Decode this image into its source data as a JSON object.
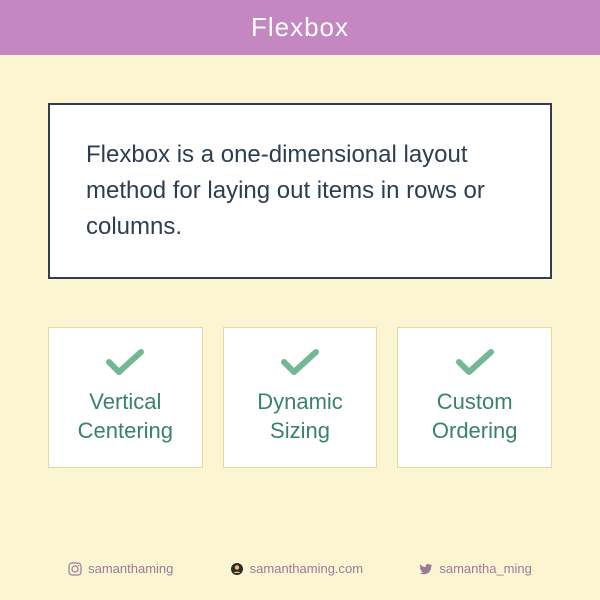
{
  "header": {
    "title": "Flexbox"
  },
  "definition": {
    "text": "Flexbox is a one-dimensional layout method for laying out items in rows or columns."
  },
  "features": [
    {
      "label": "Vertical Centering"
    },
    {
      "label": "Dynamic Sizing"
    },
    {
      "label": "Custom Ordering"
    }
  ],
  "footer": {
    "instagram": "samanthaming",
    "website": "samanthaming.com",
    "twitter": "samantha_ming"
  },
  "colors": {
    "header_bg": "#c587c2",
    "page_bg": "#fcf5d1",
    "check_green": "#73b895",
    "feature_text": "#3a8269",
    "dark_text": "#2c3e50",
    "footer_text": "#9b7a9b"
  }
}
